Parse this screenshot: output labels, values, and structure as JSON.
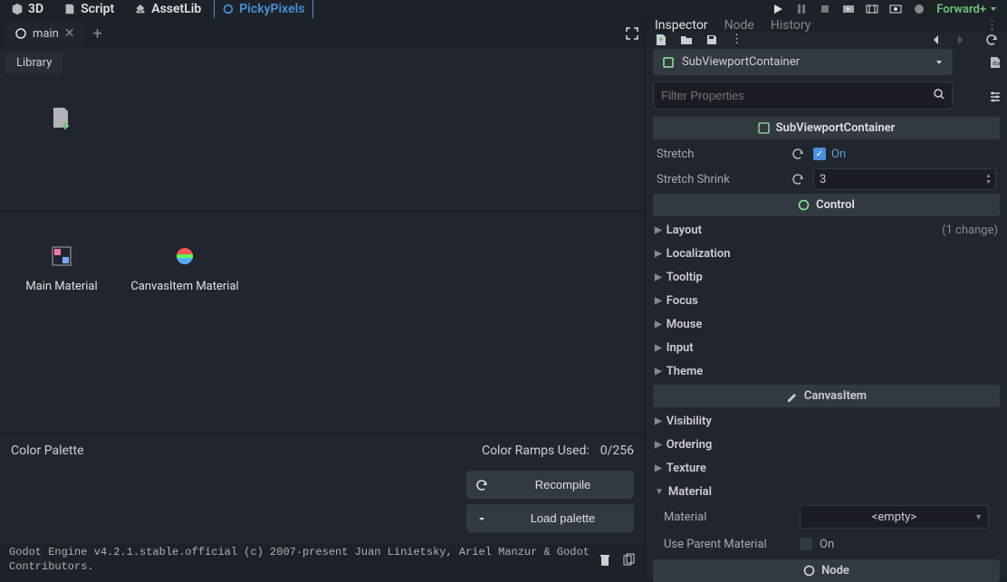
{
  "topbar": {
    "tabs": {
      "3d": "3D",
      "script": "Script",
      "assetlib": "AssetLib",
      "pickypixels": "PickyPixels"
    },
    "forward": "Forward+"
  },
  "scene": {
    "tab_name": "main",
    "library_tab": "Library"
  },
  "library": {
    "items": {
      "main_material": "Main Material",
      "canvas_material": "CanvasItem Material"
    },
    "palette_label": "Color Palette",
    "ramps_label": "Color Ramps Used:",
    "ramps_value": "0/256",
    "recompile": "Recompile",
    "load_palette": "Load palette"
  },
  "console": {
    "text": "Godot Engine v4.2.1.stable.official (c) 2007-present Juan Linietsky, Ariel Manzur & Godot Contributors."
  },
  "inspector": {
    "tabs": {
      "inspector": "Inspector",
      "node": "Node",
      "history": "History"
    },
    "node_name": "SubViewportContainer",
    "filter_placeholder": "Filter Properties",
    "sections": {
      "svc": "SubViewportContainer",
      "control": "Control",
      "canvasitem": "CanvasItem",
      "node": "Node"
    },
    "props": {
      "stretch": {
        "label": "Stretch",
        "value": "On"
      },
      "stretch_shrink": {
        "label": "Stretch Shrink",
        "value": "3"
      },
      "material": {
        "label": "Material",
        "value": "<empty>"
      },
      "use_parent": {
        "label": "Use Parent Material",
        "value": "On"
      }
    },
    "folds": {
      "layout": "Layout",
      "layout_badge": "(1 change)",
      "localization": "Localization",
      "tooltip": "Tooltip",
      "focus": "Focus",
      "mouse": "Mouse",
      "input": "Input",
      "theme": "Theme",
      "visibility": "Visibility",
      "ordering": "Ordering",
      "texture": "Texture",
      "material_fold": "Material"
    }
  }
}
